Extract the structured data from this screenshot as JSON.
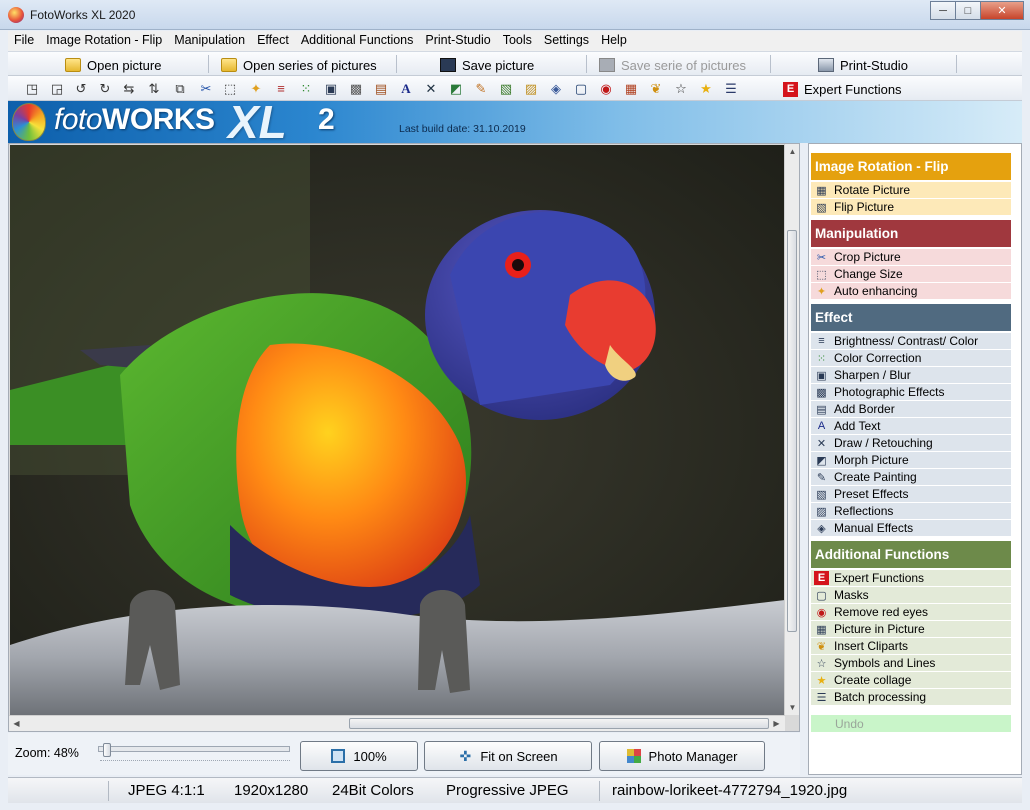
{
  "window": {
    "title": "FotoWorks XL 2020",
    "controls": {
      "minimize": "─",
      "maximize": "□",
      "close": "✕"
    }
  },
  "menu": [
    "File",
    "Image Rotation - Flip",
    "Manipulation",
    "Effect",
    "Additional Functions",
    "Print-Studio",
    "Tools",
    "Settings",
    "Help"
  ],
  "commands": {
    "open_picture": "Open picture",
    "open_series": "Open series of pictures",
    "save_picture": "Save picture",
    "save_series": "Save serie of pictures",
    "print_studio": "Print-Studio"
  },
  "toolbar": {
    "icons": [
      "rotate-left-icon",
      "rotate-right-icon",
      "rotate-ccw-icon",
      "rotate-cw-icon",
      "flip-horizontal-icon",
      "flip-vertical-icon",
      "flip-icon",
      "scissors-icon",
      "resize-icon",
      "auto-enhance-icon",
      "brightness-icon",
      "color-correction-icon",
      "sharpen-icon",
      "camera-icon",
      "border-icon",
      "text-icon",
      "draw-icon",
      "morph-icon",
      "paint-icon",
      "preset-icon",
      "reflection-icon",
      "manual-effects-icon",
      "frame-icon",
      "red-eye-icon",
      "picture-in-picture-icon",
      "clipart-icon",
      "symbols-icon",
      "star-icon",
      "batch-icon"
    ],
    "expert": "Expert Functions"
  },
  "banner": {
    "logo_foto": "foto",
    "logo_works": "WORKS",
    "logo_xl": "XL",
    "logo_num": "2",
    "build": "Last build date: 31.10.2019"
  },
  "zoom": {
    "label": "Zoom: 48%",
    "value": 48
  },
  "buttons": {
    "zoom100": "100%",
    "fit": "Fit on Screen",
    "photo_manager": "Photo Manager"
  },
  "panel": {
    "groups": [
      {
        "title": "Image Rotation - Flip",
        "color": "#e5a10e",
        "item_bg": "#fde9b8",
        "items": [
          {
            "label": "Rotate Picture",
            "icon": "rotate-picture-icon"
          },
          {
            "label": "Flip Picture",
            "icon": "flip-picture-icon"
          }
        ]
      },
      {
        "title": "Manipulation",
        "color": "#a0383e",
        "item_bg": "#f6dadb",
        "items": [
          {
            "label": "Crop Picture",
            "icon": "scissors-icon"
          },
          {
            "label": "Change Size",
            "icon": "resize-icon"
          },
          {
            "label": "Auto enhancing",
            "icon": "magic-wand-icon"
          }
        ]
      },
      {
        "title": "Effect",
        "color": "#506a80",
        "item_bg": "#dde4ec",
        "items": [
          {
            "label": "Brightness/ Contrast/ Color",
            "icon": "sliders-icon"
          },
          {
            "label": "Color Correction",
            "icon": "color-dots-icon"
          },
          {
            "label": "Sharpen / Blur",
            "icon": "sharpen-icon"
          },
          {
            "label": "Photographic Effects",
            "icon": "camera-icon"
          },
          {
            "label": "Add Border",
            "icon": "border-icon"
          },
          {
            "label": "Add Text",
            "icon": "text-icon"
          },
          {
            "label": "Draw / Retouching",
            "icon": "brush-icon"
          },
          {
            "label": "Morph Picture",
            "icon": "morph-icon"
          },
          {
            "label": "Create Painting",
            "icon": "paint-icon"
          },
          {
            "label": "Preset Effects",
            "icon": "preset-icon"
          },
          {
            "label": "Reflections",
            "icon": "reflection-icon"
          },
          {
            "label": "Manual Effects",
            "icon": "manual-effects-icon"
          }
        ]
      },
      {
        "title": "Additional Functions",
        "color": "#6d8a4a",
        "item_bg": "#e3ead8",
        "items": [
          {
            "label": "Expert Functions",
            "icon": "expert-icon"
          },
          {
            "label": "Masks",
            "icon": "mask-icon"
          },
          {
            "label": "Remove red eyes",
            "icon": "red-eye-icon"
          },
          {
            "label": "Picture in Picture",
            "icon": "picture-in-picture-icon"
          },
          {
            "label": "Insert Cliparts",
            "icon": "clipart-icon"
          },
          {
            "label": "Symbols and Lines",
            "icon": "symbols-icon"
          },
          {
            "label": "Create collage",
            "icon": "star-icon"
          },
          {
            "label": "Batch processing",
            "icon": "batch-icon"
          }
        ]
      }
    ],
    "undo": "Undo"
  },
  "status": {
    "format": "JPEG  4:1:1",
    "dimensions": "1920x1280",
    "colors": "24Bit Colors",
    "encoding": "Progressive JPEG",
    "filename": "rainbow-lorikeet-4772794_1920.jpg"
  }
}
